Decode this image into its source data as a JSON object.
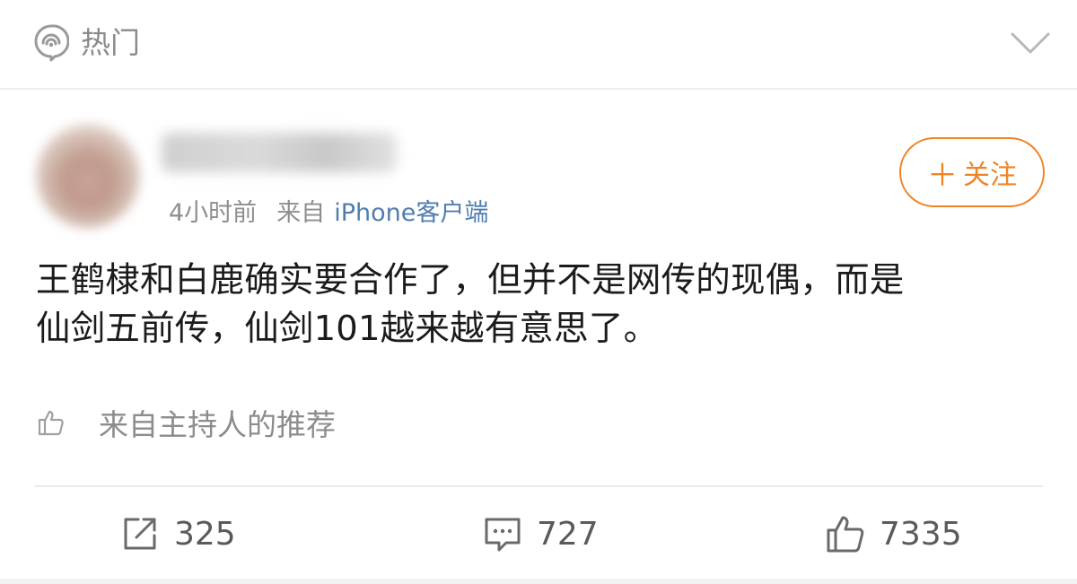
{
  "header": {
    "section_label": "热门",
    "section_icon": "hot-topic-icon",
    "collapse_icon": "chevron-down-icon"
  },
  "post": {
    "author": {
      "avatar_icon": "blurred-avatar",
      "name": ""
    },
    "time": "4小时前",
    "source_prefix": "来自",
    "source_client": "iPhone客户端",
    "follow_button_label": "关注",
    "follow_plus": "＋",
    "text_lines": [
      "王鹤棣和白鹿确实要合作了，但并不是网传的现偶，而是",
      "仙剑五前传，仙剑101越来越有意思了。"
    ],
    "recommend_label": "来自主持人的推荐",
    "actions": {
      "repost_count": "325",
      "comment_count": "727",
      "like_count": "7335"
    }
  },
  "colors": {
    "accent_follow": "#f08424",
    "link_client": "#507daf",
    "muted_text": "#8e8e8e"
  }
}
